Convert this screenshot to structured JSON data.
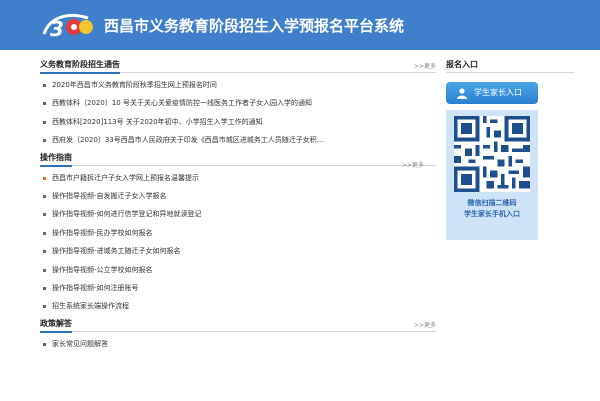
{
  "header": {
    "title": "西昌市义务教育阶段招生入学预报名平台系统"
  },
  "sections": [
    {
      "title": "义务教育阶段招生通告",
      "more": ">>更多",
      "items": [
        "2020年西昌市义务教育阶段秋季招生网上预报名时间",
        "西教体科〔2020〕10 号关于关心关爱疫情防控一线医务工作者子女入园入学的通知",
        "西教体科[2020]113号 关于2020年初中、小学招生入学工作的通知",
        "西府发〔2020〕33号西昌市人民政府关于印发《西昌市城区进城务工人员随迁子女积..."
      ]
    },
    {
      "title": "操作指南",
      "more": ">>更多",
      "items": [
        "西昌市户籍拆迁户子女入学网上预报名温馨提示",
        "操作指导视频-自发搬迁子女入学报名",
        "操作指导视频-如何进行信学登记和异地就读登记",
        "操作指导视频-民办学校如何报名",
        "操作指导视频-进城务工随迁子女如何报名",
        "操作指导视频-公立学校如何报名",
        "操作指导视频-如何注册账号",
        "招生系统家长端操作流程"
      ]
    },
    {
      "title": "政策解答",
      "more": ">>更多",
      "items": [
        "家长常见问题解答"
      ]
    }
  ],
  "sidebar": {
    "title": "报名入口",
    "login_button": "学生家长入口",
    "qr_caption_1": "微信扫描二维码",
    "qr_caption_2": "学生家长手机入口"
  },
  "colors": {
    "header_bg": "#3f7fcb",
    "accent": "#2f6ebf",
    "qr_bg": "#cfe3f6"
  }
}
